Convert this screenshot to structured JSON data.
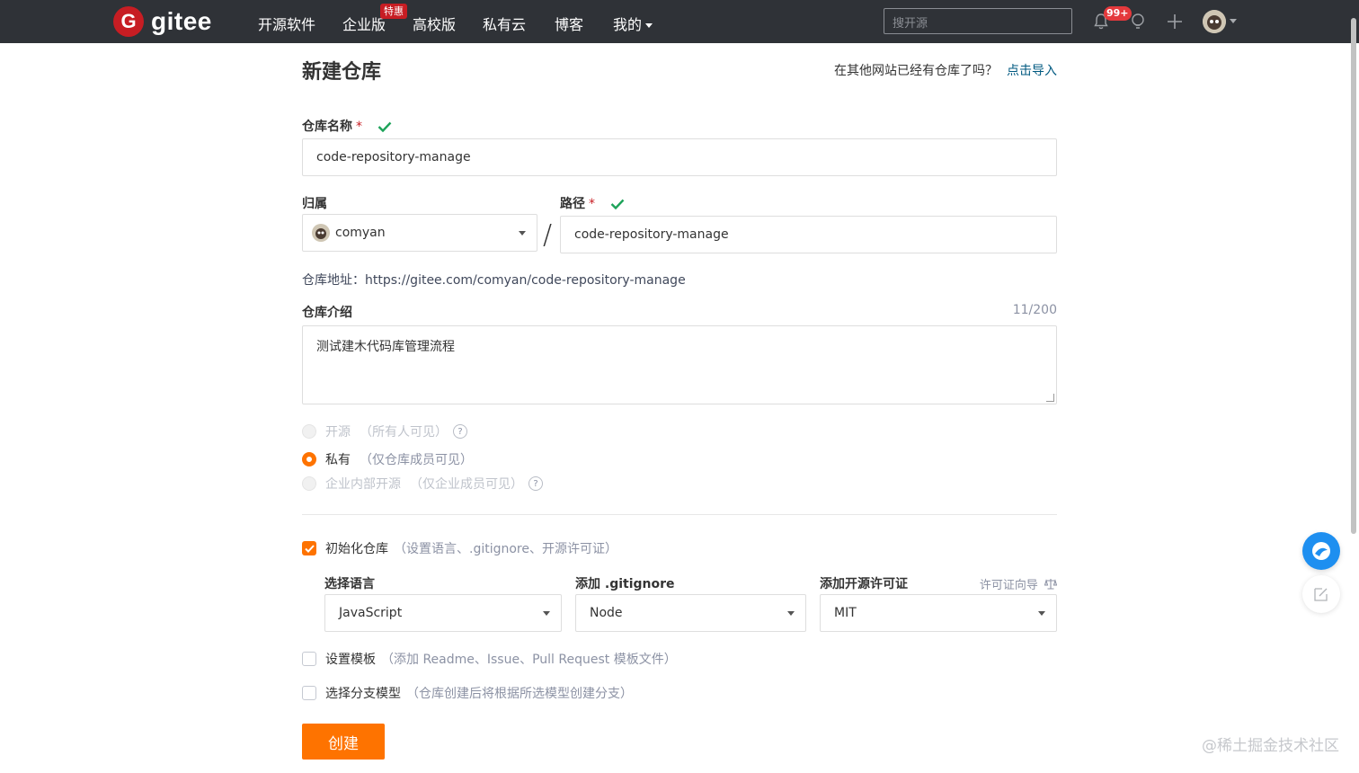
{
  "nav": {
    "logo_text": "gitee",
    "items": [
      "开源软件",
      "企业版",
      "高校版",
      "私有云",
      "博客",
      "我的"
    ],
    "enterprise_badge": "特惠",
    "search_placeholder": "搜开源",
    "notification_count": "99+"
  },
  "page": {
    "title": "新建仓库",
    "import_hint": "在其他网站已经有仓库了吗？",
    "import_link": "点击导入"
  },
  "form": {
    "repo_name_label": "仓库名称",
    "required_mark": "*",
    "repo_name_value": "code-repository-manage",
    "owner_label": "归属",
    "owner_value": "comyan",
    "separator": "/",
    "path_label": "路径",
    "path_value": "code-repository-manage",
    "repo_url_label": "仓库地址：",
    "repo_url": "https://gitee.com/comyan/code-repository-manage",
    "intro_label": "仓库介绍",
    "intro_counter": "11/200",
    "intro_value": "测试建木代码库管理流程",
    "visibility": [
      {
        "label": "开源",
        "hint": "（所有人可见）",
        "selected": false,
        "disabled": true,
        "help": true
      },
      {
        "label": "私有",
        "hint": "（仅仓库成员可见）",
        "selected": true,
        "disabled": false,
        "help": false
      },
      {
        "label": "企业内部开源",
        "hint": "（仅企业成员可见）",
        "selected": false,
        "disabled": true,
        "help": true
      }
    ],
    "help_glyph": "?",
    "init_label": "初始化仓库",
    "init_hint": "（设置语言、.gitignore、开源许可证）",
    "init_checked": true,
    "language_label": "选择语言",
    "language_value": "JavaScript",
    "gitignore_label": "添加 .gitignore",
    "gitignore_value": "Node",
    "license_label": "添加开源许可证",
    "license_guide": "许可证向导",
    "license_value": "MIT",
    "template_label": "设置模板",
    "template_hint": "（添加 Readme、Issue、Pull Request 模板文件）",
    "template_checked": false,
    "branch_label": "选择分支模型",
    "branch_hint": "（仓库创建后将根据所选模型创建分支）",
    "branch_checked": false,
    "create_button": "创建"
  },
  "watermark": "@稀土掘金技术社区",
  "colors": {
    "topbar": "#2f3237",
    "brand_red": "#c71d23",
    "accent_orange": "#fe7300",
    "link_blue": "#005980",
    "valid_green": "#1ea35a"
  }
}
